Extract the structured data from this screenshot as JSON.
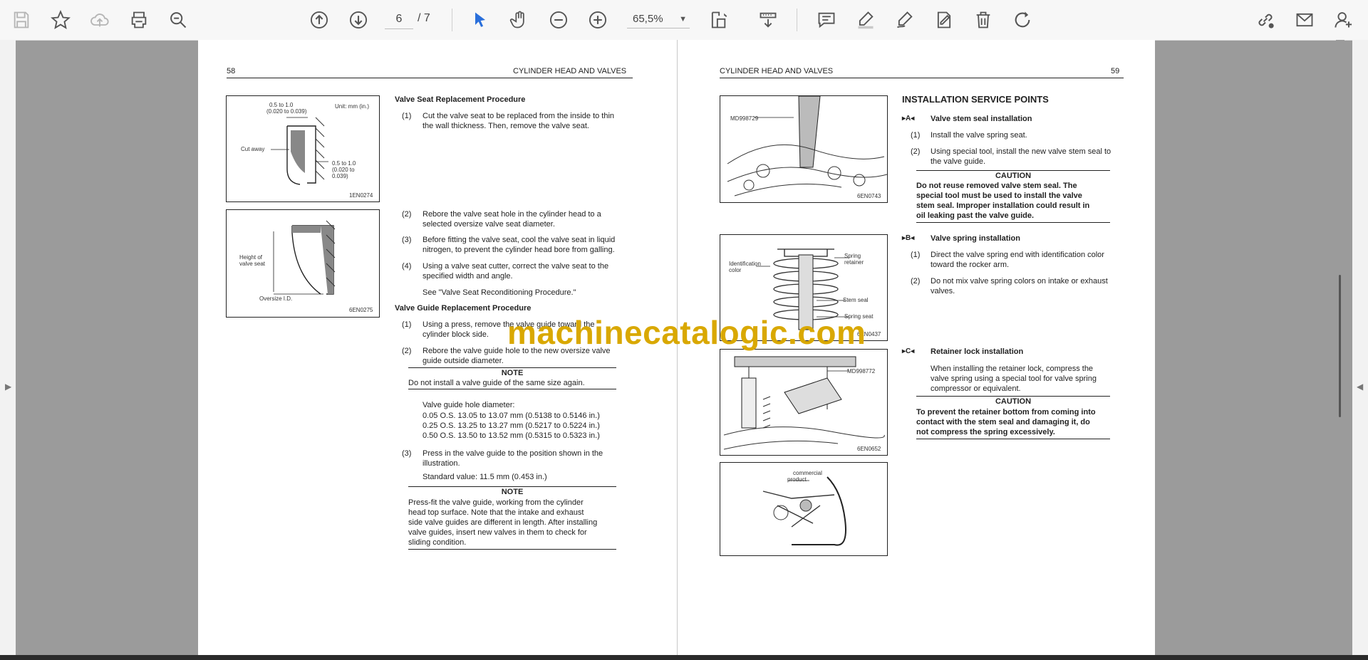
{
  "toolbar": {
    "current_page": "6",
    "total_pages": "/ 7",
    "zoom": "65,5%",
    "icons": [
      "save-icon",
      "bookmark-star-icon",
      "upload-cloud-icon",
      "print-icon",
      "zoom-search-icon",
      "page-up-icon",
      "page-down-icon",
      "select-cursor-icon",
      "hand-pan-icon",
      "zoom-out-icon",
      "zoom-in-icon",
      "fit-page-icon",
      "scroll-mode-icon",
      "comment-icon",
      "highlight-pen-icon",
      "draw-pen-icon",
      "stamp-icon",
      "delete-trash-icon",
      "rotate-icon",
      "share-link-icon",
      "email-icon",
      "add-user-icon"
    ]
  },
  "page58": {
    "page_number": "58",
    "header": "CYLINDER HEAD AND VALVES",
    "fig1": {
      "unit": "Unit: mm (in.)",
      "top_dim": "0.5 to 1.0",
      "top_dim_in": "(0.020 to 0.039)",
      "cut_away": "Cut away",
      "side_dim": "0.5 to 1.0",
      "side_dim_in": "(0.020 to",
      "side_dim_in2": "0.039)",
      "code": "1EN0274"
    },
    "fig2": {
      "height_label": "Height of",
      "height_label2": "valve seat",
      "oversize": "Oversize I.D.",
      "code": "6EN0275"
    },
    "seat_title": "Valve Seat Replacement Procedure",
    "s1_num": "(1)",
    "s1_l1": "Cut the valve seat to be replaced from the inside to thin",
    "s1_l2": "the wall thickness. Then, remove the valve seat.",
    "s2_num": "(2)",
    "s2_l1": "Rebore the valve seat hole in the cylinder head to a",
    "s2_l2": "selected oversize valve seat diameter.",
    "s3_num": "(3)",
    "s3_l1": "Before fitting the valve seat, cool the valve seat in liquid",
    "s3_l2": "nitrogen, to prevent the cylinder head bore from galling.",
    "s4_num": "(4)",
    "s4_l1": "Using a valve seat cutter, correct the valve seat to the",
    "s4_l2": "specified width and angle.",
    "see": "See \"Valve Seat Reconditioning Procedure.\"",
    "guide_title": "Valve Guide Replacement Procedure",
    "g1_num": "(1)",
    "g1_l1": "Using a press, remove the valve guide toward the",
    "g1_l2": "cylinder block side.",
    "g2_num": "(2)",
    "g2_l1": "Rebore the valve guide hole to the new oversize valve",
    "g2_l2": "guide outside diameter.",
    "note1_title": "NOTE",
    "note1_text": "Do not install a valve guide of the same size again.",
    "hole_title": "Valve guide hole diameter:",
    "hole_1": "0.05 O.S. 13.05 to 13.07 mm (0.5138 to 0.5146 in.)",
    "hole_2": "0.25 O.S. 13.25 to 13.27 mm (0.5217 to 0.5224 in.)",
    "hole_3": "0.50 O.S. 13.50 to 13.52 mm (0.5315 to 0.5323 in.)",
    "g3_num": "(3)",
    "g3_l1": "Press in the valve guide to the position shown in the",
    "g3_l2": "illustration.",
    "std_value": "Standard value:    11.5 mm (0.453 in.)",
    "note2_title": "NOTE",
    "note2_l1": "Press-fit the valve guide, working from the cylinder",
    "note2_l2": "head top surface. Note that the intake and exhaust",
    "note2_l3": "side valve guides are different in length. After installing",
    "note2_l4": "valve guides, insert new valves in them to check for",
    "note2_l5": "sliding condition."
  },
  "page59": {
    "page_number": "59",
    "header": "CYLINDER HEAD AND VALVES",
    "fig1": {
      "tool": "MD998729",
      "code": "6EN0743"
    },
    "fig2": {
      "ident1": "Identification",
      "ident2": "color",
      "spring1": "Spring",
      "spring2": "retainer",
      "stem": "Stem seal",
      "spring_seat": "Spring seat",
      "code": "6EN0437"
    },
    "fig3": {
      "tool": "MD998772",
      "code": "6EN0652"
    },
    "fig4": {
      "label1": "commercial",
      "label2": "product"
    },
    "section_title": "INSTALLATION SERVICE POINTS",
    "a_mark": "▸A◂",
    "a_title": "Valve stem seal installation",
    "a1_num": "(1)",
    "a1": "Install the valve spring seat.",
    "a2_num": "(2)",
    "a2_l1": "Using special tool, install the new valve stem seal to",
    "a2_l2": "the valve guide.",
    "caution1_title": "CAUTION",
    "caution1_l1": "Do not reuse removed valve stem seal. The",
    "caution1_l2": "special tool must be used to install the valve",
    "caution1_l3": "stem seal. Improper installation could result in",
    "caution1_l4": "oil leaking past the valve guide.",
    "b_mark": "▸B◂",
    "b_title": "Valve spring installation",
    "b1_num": "(1)",
    "b1_l1": "Direct the valve spring end with identification color",
    "b1_l2": "toward the rocker arm.",
    "b2_num": "(2)",
    "b2_l1": "Do not mix valve spring colors on intake or exhaust",
    "b2_l2": "valves.",
    "c_mark": "▸C◂",
    "c_title": "Retainer lock installation",
    "c_l1": "When installing the retainer lock, compress the",
    "c_l2": "valve spring using a special tool for valve spring",
    "c_l3": "compressor or equivalent.",
    "caution2_title": "CAUTION",
    "caution2_l1": "To prevent the retainer bottom from coming into",
    "caution2_l2": "contact with the stem seal and damaging it, do",
    "caution2_l3": "not compress the spring excessively."
  },
  "watermark": "machinecatalogic.com",
  "colors": {
    "accent": "#2a6fdb",
    "watermark": "#d9a800",
    "canvas": "#9b9b9b"
  }
}
